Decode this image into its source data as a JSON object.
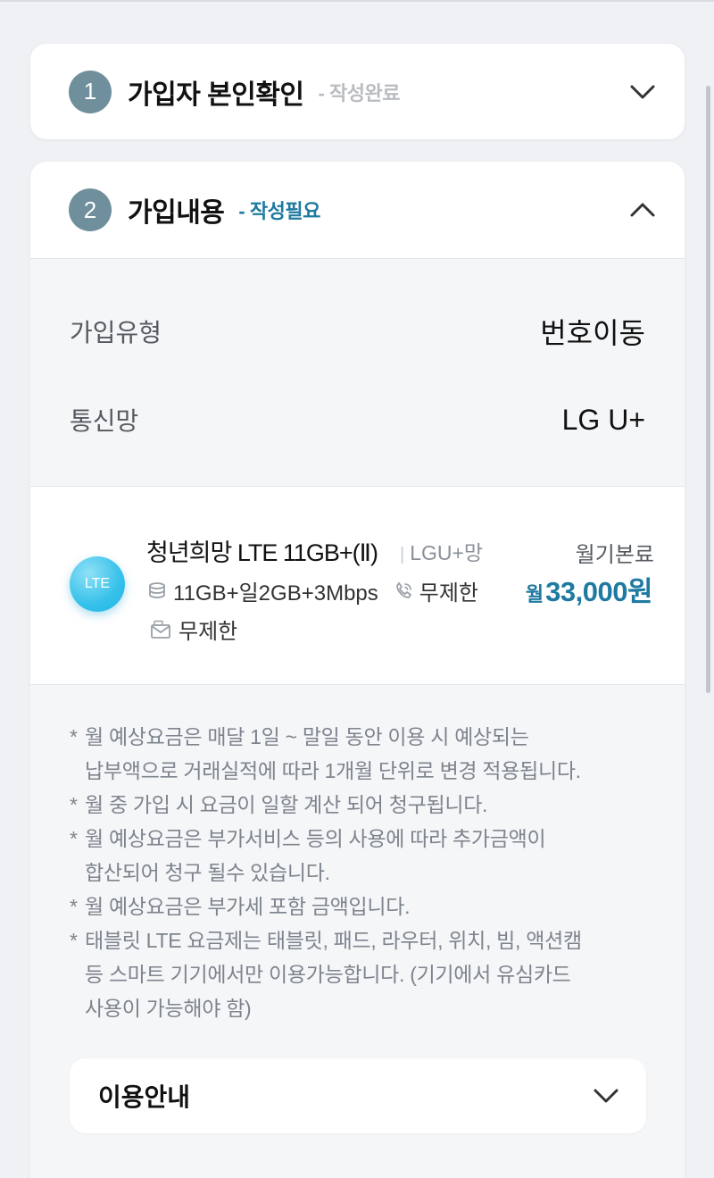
{
  "step1": {
    "number": "1",
    "title": "가입자 본인확인",
    "status": "- 작성완료"
  },
  "step2": {
    "number": "2",
    "title": "가입내용",
    "status": "- 작성필요"
  },
  "summary": {
    "join_type_label": "가입유형",
    "join_type_value": "번호이동",
    "network_label": "통신망",
    "network_value": "LG U+"
  },
  "plan": {
    "badge": "LTE",
    "name": "청년희망 LTE 11GB+(Ⅱ)",
    "network": "LGU+망",
    "base_label": "월기본료",
    "data": "11GB+일2GB+3Mbps",
    "calls": "무제한",
    "sms": "무제한",
    "price_prefix": "월",
    "price": "33,000원"
  },
  "notes": [
    {
      "star": "*",
      "text": "월 예상요금은 매달 1일 ~ 말일 동안 이용 시 예상되는"
    },
    {
      "star": "",
      "text": "납부액으로 거래실적에 따라 1개월 단위로 변경 적용됩니다."
    },
    {
      "star": "*",
      "text": "월 중 가입 시 요금이 일할 계산 되어 청구됩니다."
    },
    {
      "star": "*",
      "text": "월 예상요금은 부가서비스 등의 사용에 따라 추가금액이"
    },
    {
      "star": "",
      "text": "합산되어 청구 될수 있습니다."
    },
    {
      "star": "*",
      "text": "월 예상요금은 부가세 포함 금액입니다."
    },
    {
      "star": "*",
      "text": "태블릿 LTE 요금제는 태블릿, 패드, 라우터, 위치, 빔, 액션캠"
    },
    {
      "star": "",
      "text": "등 스마트 기기에서만 이용가능합니다. (기기에서 유심카드"
    },
    {
      "star": "",
      "text": "사용이 가능해야 함)"
    }
  ],
  "guide": {
    "title": "이용안내"
  },
  "colors": {
    "accent": "#1e7aa0",
    "step_circle": "#6f8f9c",
    "done": "#b9bcc1"
  },
  "icons": {
    "step1_toggle": "chevron-down-icon",
    "step2_toggle": "chevron-up-icon",
    "data": "data-icon",
    "call": "phone-icon",
    "sms": "message-icon",
    "guide_toggle": "chevron-down-icon"
  }
}
